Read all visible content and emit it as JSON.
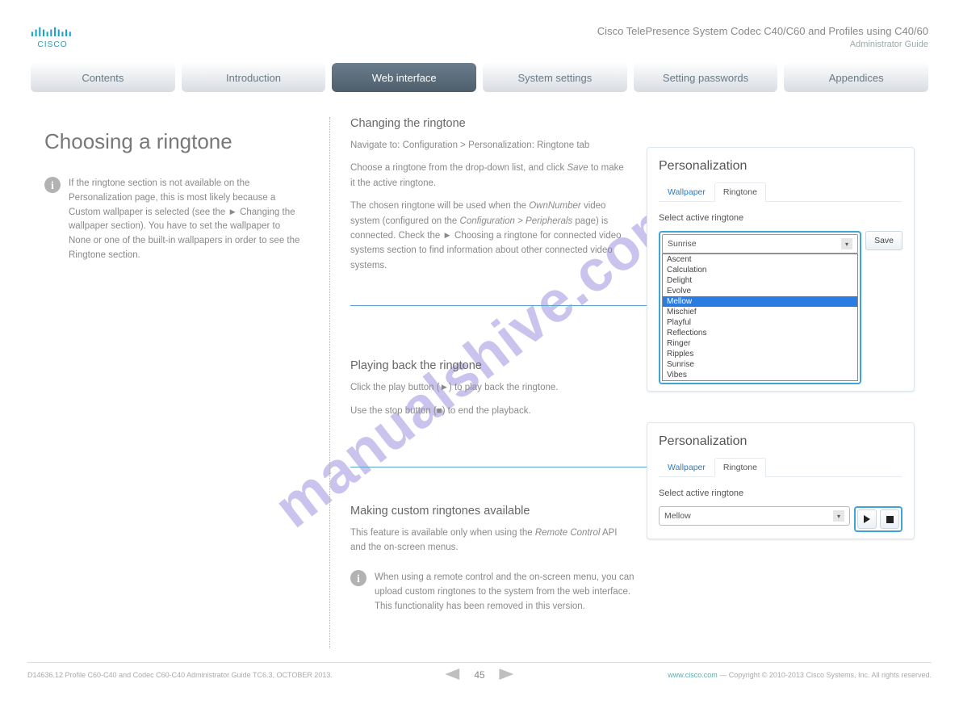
{
  "header": {
    "doc_title": "Cisco TelePresence System Codec C40/C60 and Profiles using C40/60",
    "doc_subtitle": "Administrator Guide"
  },
  "nav": {
    "items": [
      "Contents",
      "Introduction",
      "Web interface",
      "System settings",
      "Setting passwords",
      "Appendices"
    ]
  },
  "sidebar": {
    "title": "Choosing a ringtone",
    "note": "If the ringtone section is not available on the Personalization page, this is most likely because a Custom wallpaper is selected (see the ► Changing the wallpaper section). You have to set the wallpaper to None or one of the built-in wallpapers in order to see the Ringtone section."
  },
  "sections": {
    "s1": {
      "heading": "Changing the ringtone",
      "p1": "Navigate to: Configuration > Personalization: Ringtone tab",
      "p2a": "Choose a ringtone from the drop-down list, and click ",
      "p2_btn": "Save",
      "p2b": " to make it the active ringtone.",
      "p3a_part1": "The chosen ringtone will be used when the ",
      "p3a_em": "OwnNumber",
      "p3a_part2": " video system (configured on the ",
      "p3b_em": "Configuration > Peripherals",
      "p3b": " page) is connected. Check the ► Choosing a ringtone for connected video systems section to find information about other connected video systems."
    },
    "s2": {
      "heading": "Playing back the ringtone",
      "p1": "Click the play button (►) to play back the ringtone.",
      "p2": "Use the stop button (■) to end the playback."
    },
    "s3": {
      "heading": "Making custom ringtones available",
      "p1a": "This feature is available only when using the ",
      "p1_em": "Remote Control",
      "p1b": " API and the on-screen menus.",
      "note_icon": true,
      "note": "When using a remote control and the on-screen menu, you can upload custom ringtones to the system from the web interface. This functionality has been removed in this version."
    }
  },
  "panel": {
    "title": "Personalization",
    "tab_wallpaper": "Wallpaper",
    "tab_ringtone": "Ringtone",
    "label": "Select active ringtone",
    "selected1": "Sunrise",
    "selected2": "Mellow",
    "save_btn": "Save",
    "options": [
      "Ascent",
      "Calculation",
      "Delight",
      "Evolve",
      "Mellow",
      "Mischief",
      "Playful",
      "Reflections",
      "Ringer",
      "Ripples",
      "Sunrise",
      "Vibes"
    ]
  },
  "footer": {
    "left": "D14636.12 Profile C60-C40 and Codec C60-C40 Administrator Guide TC6.3, OCTOBER 2013.",
    "page": "45",
    "right_prefix": "www.cisco.com",
    "right_suffix": " — Copyright © 2010-2013 Cisco Systems, Inc. All rights reserved."
  },
  "watermark": "manualshive.com"
}
